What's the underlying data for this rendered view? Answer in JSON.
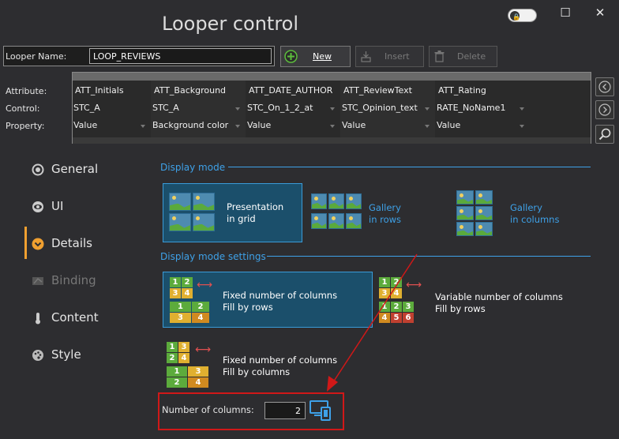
{
  "window": {
    "title": "Looper control",
    "close_glyph": "✕",
    "maximize_glyph": "☐"
  },
  "looper": {
    "name_label": "Looper Name:",
    "name_value": "LOOP_REVIEWS",
    "new_label": "New",
    "insert_label": "Insert",
    "delete_label": "Delete"
  },
  "table": {
    "row_labels": [
      "Attribute:",
      "Control:",
      "Property:"
    ],
    "columns": [
      {
        "attribute": "ATT_Initials",
        "control": "STC_A",
        "property": "Value"
      },
      {
        "attribute": "ATT_Background",
        "control": "STC_A",
        "property": "Background color"
      },
      {
        "attribute": "ATT_DATE_AUTHOR",
        "control": "STC_On_1_2_at",
        "property": "Value"
      },
      {
        "attribute": "ATT_ReviewText",
        "control": "STC_Opinion_text",
        "property": "Value"
      },
      {
        "attribute": "ATT_Rating",
        "control": "RATE_NoName1",
        "property": "Value"
      }
    ]
  },
  "nav": {
    "items": [
      {
        "label": "General",
        "icon": "radio-icon"
      },
      {
        "label": "UI",
        "icon": "eye-icon"
      },
      {
        "label": "Details",
        "icon": "chevron-circle-icon"
      },
      {
        "label": "Binding",
        "icon": "binding-icon"
      },
      {
        "label": "Content",
        "icon": "thermometer-icon"
      },
      {
        "label": "Style",
        "icon": "palette-icon"
      }
    ]
  },
  "display_mode": {
    "title": "Display mode",
    "options": [
      {
        "line1": "Presentation",
        "line2": "in grid"
      },
      {
        "line1": "Gallery",
        "line2": "in rows"
      },
      {
        "line1": "Gallery",
        "line2": "in columns"
      }
    ]
  },
  "display_settings": {
    "title": "Display mode settings",
    "options": [
      {
        "line1": "Fixed number of columns",
        "line2": "Fill by rows"
      },
      {
        "line1": "Variable number of columns",
        "line2": "Fill by rows"
      },
      {
        "line1": "Fixed number of columns",
        "line2": "Fill by columns"
      }
    ],
    "numbers": [
      "1",
      "2",
      "3",
      "4",
      "5",
      "6"
    ]
  },
  "columns_setting": {
    "label": "Number of columns:",
    "value": "2"
  },
  "colors": {
    "accent": "#3ea1e8",
    "highlight": "#d01818",
    "active_nav": "#f0a030"
  }
}
